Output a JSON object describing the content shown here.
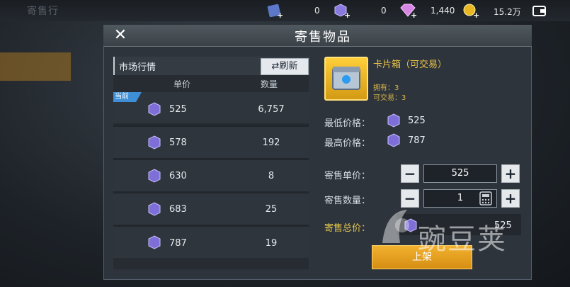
{
  "topbar": {
    "game_title": "寄售行",
    "resources": [
      {
        "icon": "ticket-icon",
        "value": "0"
      },
      {
        "icon": "purple-crystal-icon",
        "value": "0"
      },
      {
        "icon": "diamond-icon",
        "value": "1,440"
      },
      {
        "icon": "gold-coin-icon",
        "value": "15.2万"
      }
    ]
  },
  "dialog": {
    "title": "寄售物品",
    "market": {
      "label": "市场行情",
      "refresh": "刷新",
      "col_price": "单价",
      "col_qty": "数量",
      "current_badge": "当前",
      "rows": [
        {
          "price": "525",
          "qty": "6,757"
        },
        {
          "price": "578",
          "qty": "192"
        },
        {
          "price": "630",
          "qty": "8"
        },
        {
          "price": "683",
          "qty": "25"
        },
        {
          "price": "787",
          "qty": "19"
        }
      ]
    },
    "item": {
      "name": "卡片箱（可交易）",
      "owned": "拥有：3",
      "tradable": "可交易：3",
      "min_label": "最低价格：",
      "min_value": "525",
      "max_label": "最高价格：",
      "max_value": "787"
    },
    "form": {
      "unit_price_label": "寄售单价：",
      "unit_price_value": "525",
      "quantity_label": "寄售数量：",
      "quantity_value": "1",
      "total_label": "寄售总价：",
      "total_value": "525",
      "confirm": "上架"
    }
  },
  "watermark": "豌豆荚",
  "colors": {
    "accent_gold": "#e9c24a",
    "refresh_bg": "#e5e8ec",
    "badge_blue": "#3f8fd6"
  }
}
